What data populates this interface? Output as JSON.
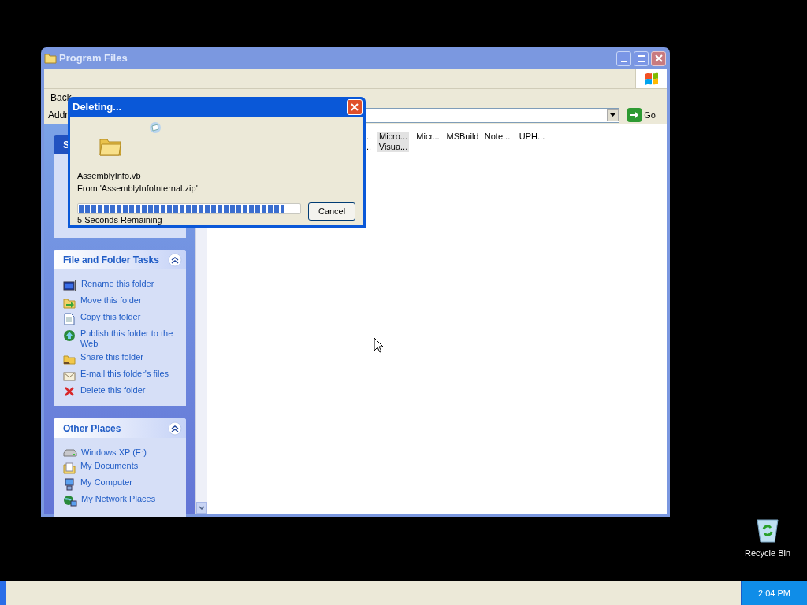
{
  "explorer": {
    "title": "Program Files",
    "toolbar": {
      "back": "Back"
    },
    "address": {
      "label": "Addr",
      "go": "Go"
    },
    "sidebar": {
      "panels": [
        {
          "title": "S"
        },
        {
          "title": "File and Folder Tasks",
          "items": [
            {
              "kind": "rename",
              "label": "Rename this folder"
            },
            {
              "kind": "move",
              "label": "Move this folder"
            },
            {
              "kind": "copy",
              "label": "Copy this folder"
            },
            {
              "kind": "publish",
              "label": "Publish this folder to the Web"
            },
            {
              "kind": "share",
              "label": "Share this folder"
            },
            {
              "kind": "email",
              "label": "E-mail this folder's files"
            },
            {
              "kind": "delete",
              "label": "Delete this folder"
            }
          ]
        },
        {
          "title": "Other Places",
          "items": [
            {
              "kind": "drive",
              "label": "Windows XP (E:)"
            },
            {
              "kind": "documents",
              "label": "My Documents"
            },
            {
              "kind": "computer",
              "label": "My Computer"
            },
            {
              "kind": "network",
              "label": "My Network Places"
            }
          ]
        }
      ]
    },
    "files": [
      [
        {
          "label": "..",
          "selected": false
        },
        {
          "label": "Micro...",
          "selected": true
        },
        {
          "label": "Micr...",
          "selected": false
        },
        {
          "label": "MSBuild",
          "selected": false
        },
        {
          "label": "Note...",
          "selected": false
        },
        {
          "label": "UPH...",
          "selected": false
        }
      ],
      [
        {
          "label": "..",
          "selected": false
        },
        {
          "label": "Visua...",
          "selected": true
        }
      ]
    ]
  },
  "dialog": {
    "title": "Deleting...",
    "file": "AssemblyInfo.vb",
    "source": "From 'AssemblyInfoInternal.zip'",
    "progress": {
      "level": 0.93
    },
    "remaining": "5 Seconds Remaining",
    "cancel": "Cancel"
  },
  "desktop": {
    "icons": [
      {
        "label": "Recycle Bin"
      }
    ]
  },
  "taskbar": {
    "clock": "2:04 PM"
  }
}
